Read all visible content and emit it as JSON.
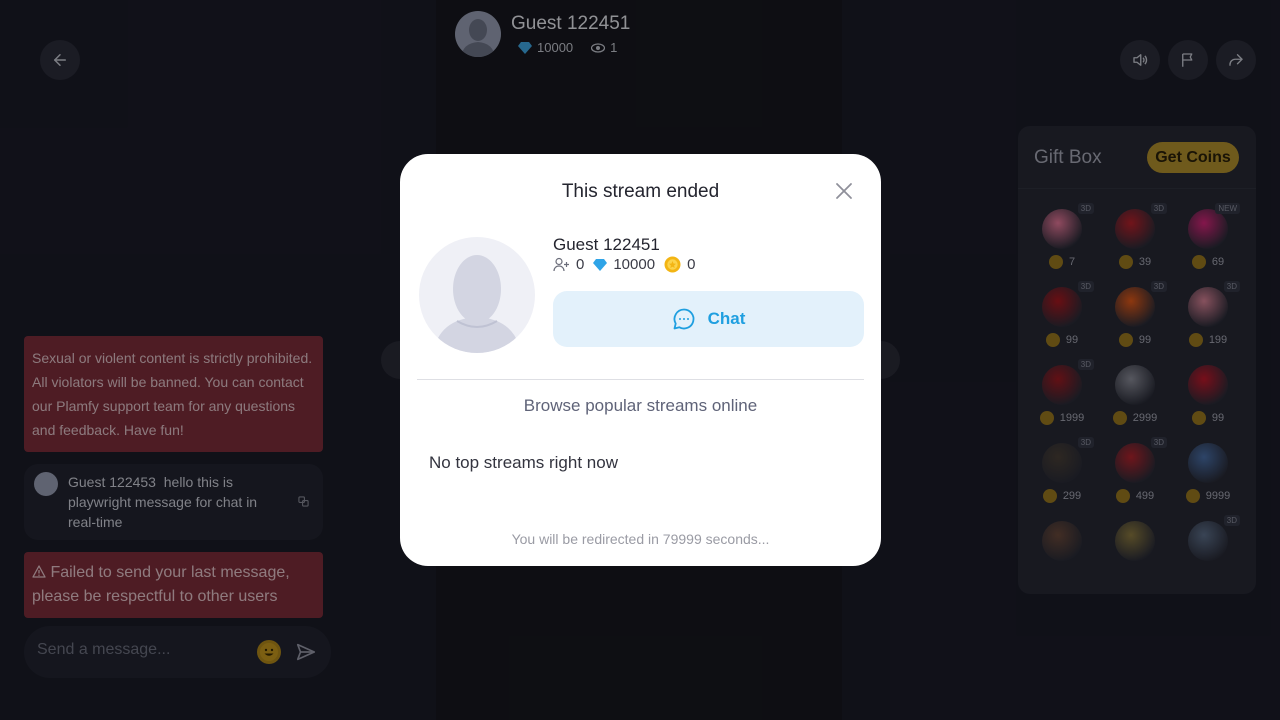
{
  "streamer": {
    "name": "Guest 122451",
    "diamonds": "10000",
    "viewers": "1"
  },
  "chat": {
    "rules_text": "Sexual or violent content is strictly prohibited. All violators will be banned. You can contact our Plamfy support team for any questions and feedback. Have fun!",
    "message": {
      "author": "Guest 122453",
      "text": "hello this is playwright message for chat in real-time"
    },
    "error_text": "Failed to send your last message, please be respectful to other users",
    "composer_placeholder": "Send a message..."
  },
  "giftbox": {
    "title": "Gift Box",
    "get_coins_label": "Get Coins",
    "gifts": [
      {
        "name": "follow-me-heart",
        "price": "7",
        "tag": "3D",
        "color": "#e8789a"
      },
      {
        "name": "strawberry",
        "price": "39",
        "tag": "3D",
        "color": "#b8212b"
      },
      {
        "name": "lips",
        "price": "69",
        "tag": "NEW",
        "color": "#d6257a"
      },
      {
        "name": "rose",
        "price": "99",
        "tag": "3D",
        "color": "#a91820"
      },
      {
        "name": "fire",
        "price": "99",
        "tag": "3D",
        "color": "#e45a19"
      },
      {
        "name": "teddy-bear",
        "price": "199",
        "tag": "3D",
        "color": "#d98397"
      },
      {
        "name": "rose-bouquet",
        "price": "1999",
        "tag": "3D",
        "color": "#9e1a22"
      },
      {
        "name": "tiara",
        "price": "2999",
        "tag": "",
        "color": "#8b8d99"
      },
      {
        "name": "heart",
        "price": "99",
        "tag": "",
        "color": "#c0182b"
      },
      {
        "name": "champagne",
        "price": "299",
        "tag": "3D",
        "color": "#4a4038"
      },
      {
        "name": "gift-box",
        "price": "499",
        "tag": "3D",
        "color": "#b3242d"
      },
      {
        "name": "eiffel-tower",
        "price": "9999",
        "tag": "",
        "color": "#4a6fa8"
      },
      {
        "name": "handshake",
        "price": "",
        "tag": "",
        "color": "#6b4a3a"
      },
      {
        "name": "laughing-face",
        "price": "",
        "tag": "",
        "color": "#8c7a40"
      },
      {
        "name": "ring",
        "price": "",
        "tag": "3D",
        "color": "#5d6f8a"
      }
    ]
  },
  "modal": {
    "title": "This stream ended",
    "user_name": "Guest 122451",
    "followers": "0",
    "diamonds": "10000",
    "coins": "0",
    "chat_label": "Chat",
    "browse_text": "Browse popular streams online",
    "no_streams_text": "No top streams right now",
    "redirect_text": "You will be redirected in 79999 seconds..."
  }
}
